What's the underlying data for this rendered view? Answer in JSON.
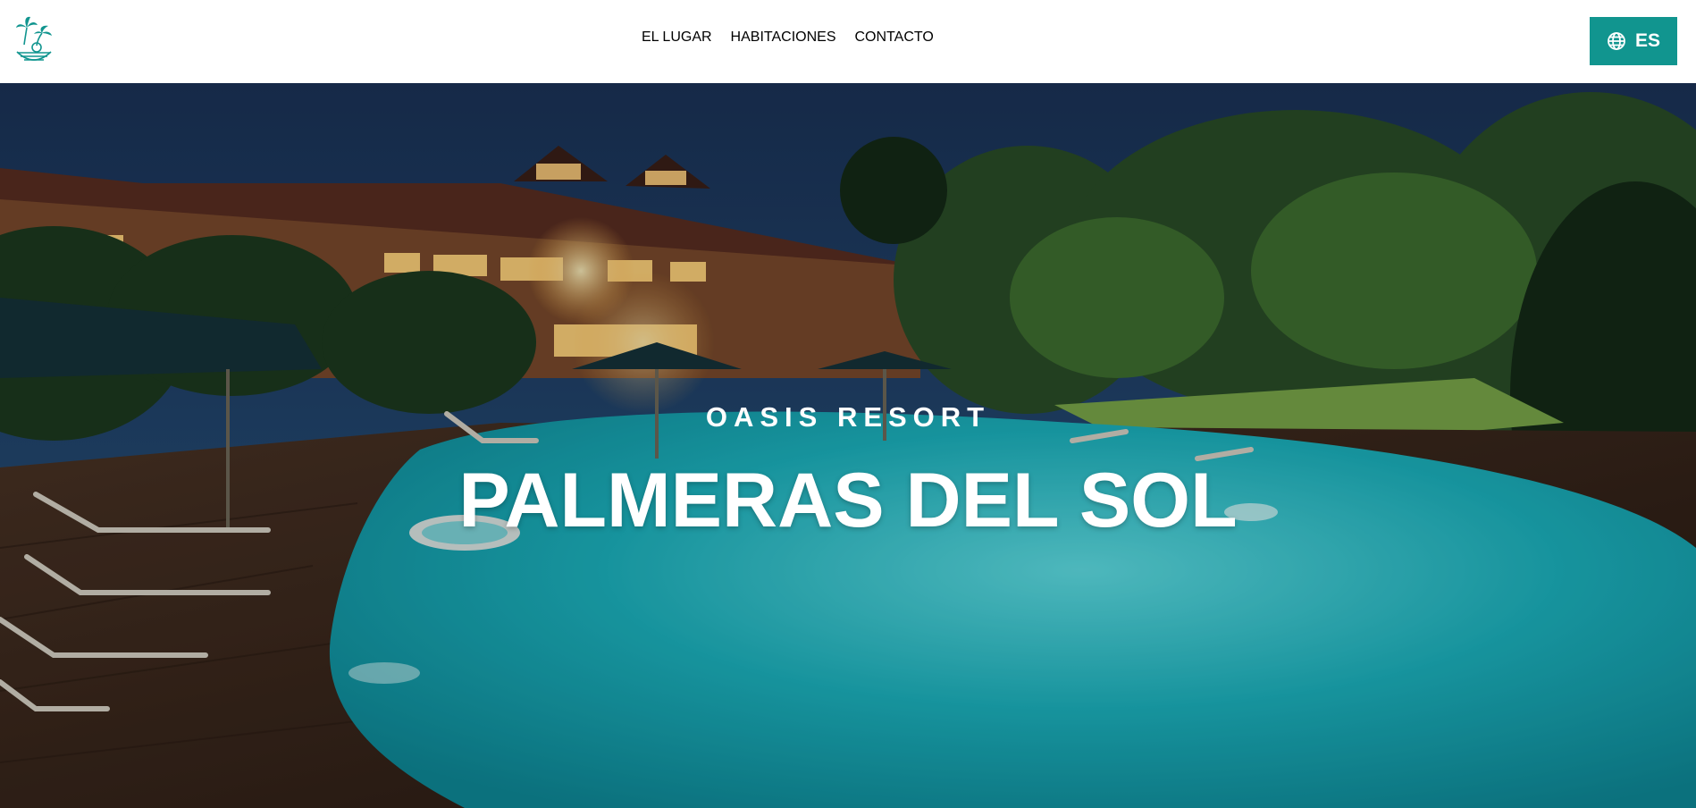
{
  "header": {
    "logo_name": "palm-island-logo",
    "nav": [
      {
        "label": "EL LUGAR"
      },
      {
        "label": "HABITACIONES"
      },
      {
        "label": "CONTACTO"
      }
    ],
    "language": {
      "icon": "globe-icon",
      "label": "ES"
    }
  },
  "hero": {
    "eyebrow": "OASIS RESORT",
    "title": "PALMERAS DEL SOL"
  },
  "colors": {
    "accent": "#11958f",
    "nav_text": "#11918f",
    "pool": "#1fb8c3",
    "sky": "#1d3d63"
  }
}
